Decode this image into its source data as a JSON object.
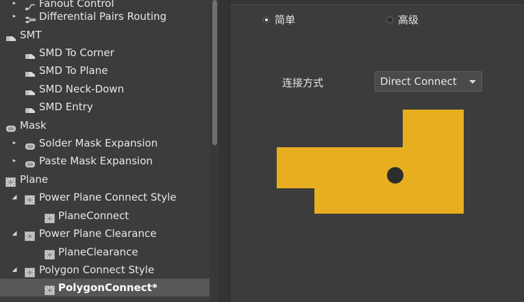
{
  "colors": {
    "panel_bg": "#3c3c3c",
    "selection_bg": "#575757",
    "pad_fill": "#e7ae20",
    "via_hole": "#2d2d2d"
  },
  "tree": {
    "items": [
      {
        "label": "Fanout Control",
        "icon": "route-icon",
        "expander": "collapsed"
      },
      {
        "label": "Differential Pairs Routing",
        "icon": "diff-pair-icon",
        "expander": "collapsed"
      },
      {
        "label": "SMT",
        "icon": "smt-icon",
        "expander": "none"
      },
      {
        "label": "SMD To Corner",
        "icon": "smt-icon",
        "expander": "none"
      },
      {
        "label": "SMD To Plane",
        "icon": "smt-icon",
        "expander": "none"
      },
      {
        "label": "SMD Neck-Down",
        "icon": "smt-icon",
        "expander": "none"
      },
      {
        "label": "SMD Entry",
        "icon": "smt-icon",
        "expander": "none"
      },
      {
        "label": "Mask",
        "icon": "mask-icon",
        "expander": "none"
      },
      {
        "label": "Solder Mask Expansion",
        "icon": "mask-icon",
        "expander": "collapsed"
      },
      {
        "label": "Paste Mask Expansion",
        "icon": "mask-icon",
        "expander": "collapsed"
      },
      {
        "label": "Plane",
        "icon": "plane-icon",
        "expander": "none"
      },
      {
        "label": "Power Plane Connect Style",
        "icon": "plane-icon",
        "expander": "expanded"
      },
      {
        "label": "PlaneConnect",
        "icon": "plane-icon",
        "expander": "none"
      },
      {
        "label": "Power Plane Clearance",
        "icon": "plane-icon",
        "expander": "expanded"
      },
      {
        "label": "PlaneClearance",
        "icon": "plane-icon",
        "expander": "none"
      },
      {
        "label": "Polygon Connect Style",
        "icon": "plane-icon",
        "expander": "expanded"
      },
      {
        "label": "PolygonConnect*",
        "icon": "plane-icon",
        "expander": "none",
        "selected": true
      }
    ]
  },
  "mode": {
    "simple_label": "简单",
    "advanced_label": "高级",
    "selected": "simple"
  },
  "connect": {
    "label": "连接方式",
    "value": "Direct Connect"
  }
}
